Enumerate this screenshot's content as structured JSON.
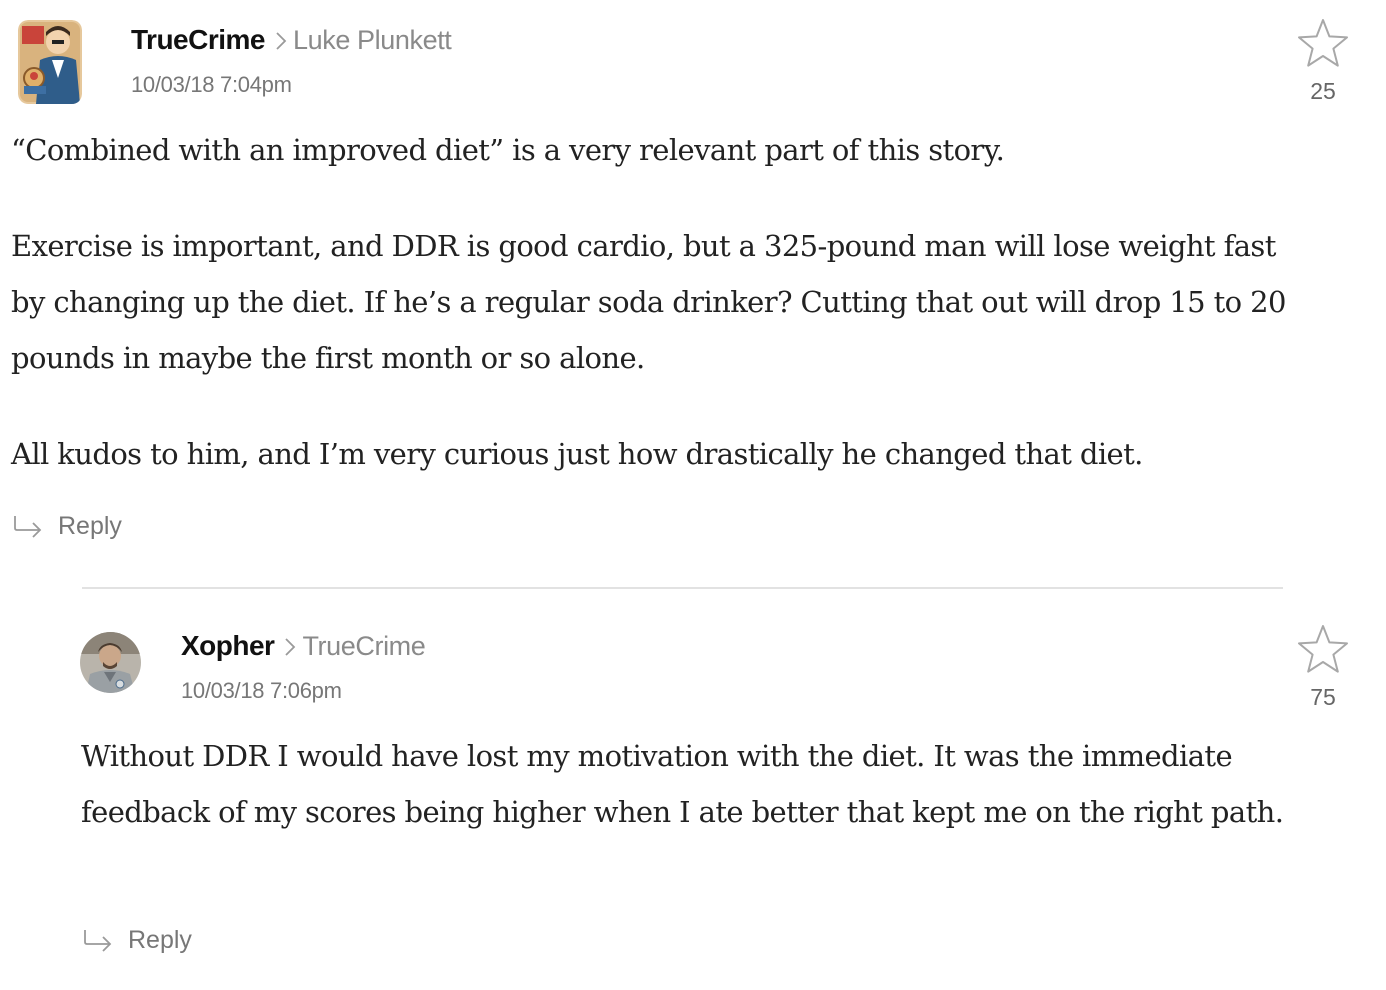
{
  "comments": [
    {
      "author": "TrueCrime",
      "reply_to": "Luke Plunkett",
      "timestamp": "10/03/18 7:04pm",
      "star_count": "25",
      "avatar_icon": "comic-reporter-avatar",
      "paragraphs": [
        "“Combined with an improved diet” is a very relevant part of this story.",
        "Exercise is important, and DDR is good cardio, but a 325-pound man will lose weight fast by changing up the diet. If he’s a regular soda drinker? Cutting that out will drop 15 to 20 pounds in maybe the first month or so alone.",
        "All kudos to him, and I’m very curious just how drastically he changed that diet."
      ],
      "reply_label": "Reply"
    },
    {
      "author": "Xopher",
      "reply_to": "TrueCrime",
      "timestamp": "10/03/18 7:06pm",
      "star_count": "75",
      "avatar_icon": "photo-avatar",
      "paragraphs": [
        "Without DDR I would have lost my motivation with the diet. It was the immediate feedback of my scores being higher when I ate better that kept me on the right path."
      ],
      "reply_label": "Reply"
    }
  ],
  "colors": {
    "author": "#111111",
    "muted": "#8a8a8a",
    "body": "#222222",
    "divider": "#e2e2e2"
  }
}
